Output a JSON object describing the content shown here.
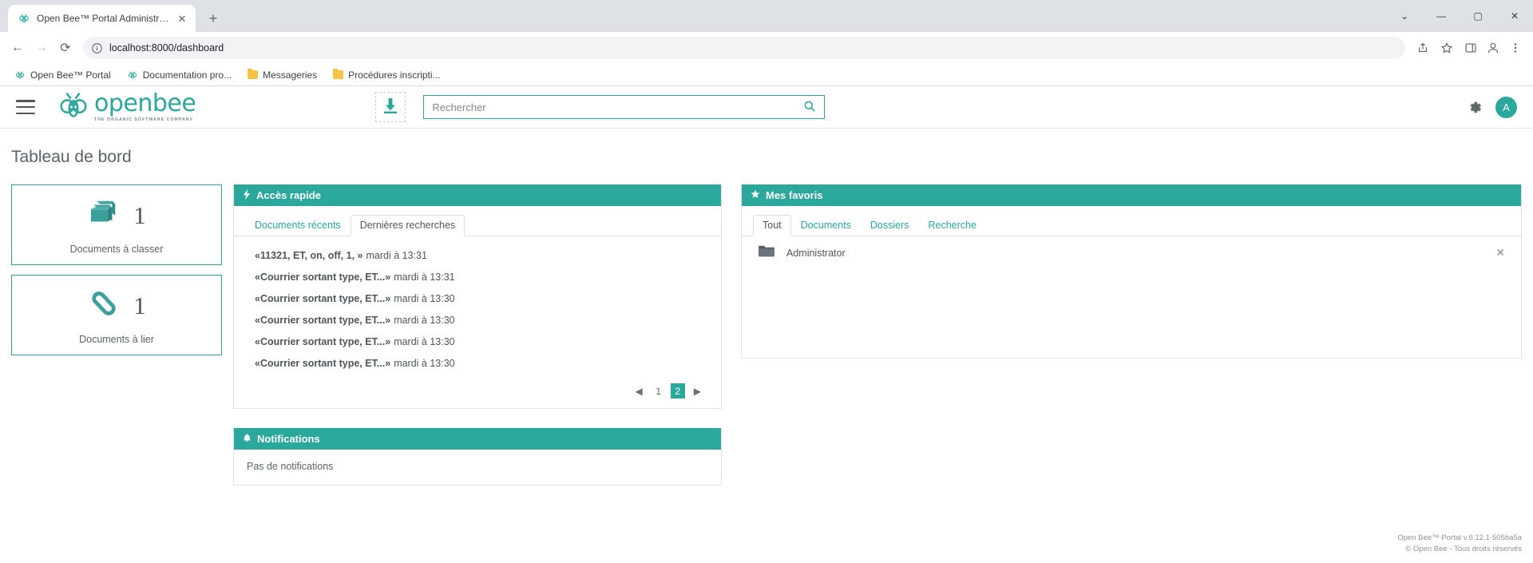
{
  "browser": {
    "tab": {
      "title": "Open Bee™ Portal Administrator",
      "favicon": "bee-icon",
      "close": "✕"
    },
    "newtab_label": "+",
    "window_controls": {
      "minimize": "—",
      "maximize": "▢",
      "close": "✕",
      "chevron": "⌄"
    },
    "nav": {
      "back": "←",
      "forward": "→",
      "reload": "⟳"
    },
    "omnibox": {
      "url": "localhost:8000/dashboard",
      "info_icon": "info-circle-icon"
    },
    "toolbar_icons": {
      "share": "share-icon",
      "bookmark": "star-icon",
      "sidepanel": "side-panel-icon",
      "profile": "profile-icon",
      "menu": "kebab-menu-icon"
    },
    "bookmarks": [
      {
        "label": "Open Bee™ Portal",
        "icon": "bee-icon"
      },
      {
        "label": "Documentation pro...",
        "icon": "bee-icon"
      },
      {
        "label": "Messageries",
        "icon": "folder-icon"
      },
      {
        "label": "Procédures inscripti...",
        "icon": "folder-icon"
      }
    ]
  },
  "app": {
    "header": {
      "menu_icon": "hamburger-menu-icon",
      "logo_word": "openbee",
      "logo_tagline": "THE ORGANIC SOFTWARE COMPANY",
      "upload_icon": "download-upload-icon",
      "search_placeholder": "Rechercher",
      "search_value": "",
      "search_icon": "magnifier-icon",
      "settings_icon": "gear-icon",
      "avatar_letter": "A"
    },
    "page_title": "Tableau de bord",
    "stats": [
      {
        "count": "1",
        "label": "Documents à classer",
        "icon": "documents-stack-icon"
      },
      {
        "count": "1",
        "label": "Documents à lier",
        "icon": "link-chain-icon"
      }
    ],
    "quick_access": {
      "title": "Accès rapide",
      "icon": "lightning-bolt-icon",
      "tabs": [
        {
          "label": "Documents récents",
          "active": false
        },
        {
          "label": "Dernières recherches",
          "active": true
        }
      ],
      "items": [
        {
          "query": "«11321, ET, on, off, 1, »",
          "time": "mardi à 13:31"
        },
        {
          "query": "«Courrier sortant type, ET...»",
          "time": "mardi à 13:31"
        },
        {
          "query": "«Courrier sortant type, ET...»",
          "time": "mardi à 13:30"
        },
        {
          "query": "«Courrier sortant type, ET...»",
          "time": "mardi à 13:30"
        },
        {
          "query": "«Courrier sortant type, ET...»",
          "time": "mardi à 13:30"
        },
        {
          "query": "«Courrier sortant type, ET...»",
          "time": "mardi à 13:30"
        }
      ],
      "pagination": {
        "prev": "◀",
        "next": "▶",
        "pages": [
          "1",
          "2"
        ],
        "current": "2"
      }
    },
    "favorites": {
      "title": "Mes favoris",
      "icon": "star-icon",
      "tabs": [
        {
          "label": "Tout",
          "active": true
        },
        {
          "label": "Documents",
          "active": false
        },
        {
          "label": "Dossiers",
          "active": false
        },
        {
          "label": "Recherche",
          "active": false
        }
      ],
      "items": [
        {
          "name": "Administrator",
          "icon": "folder-icon",
          "remove": "✕"
        }
      ]
    },
    "notifications": {
      "title": "Notifications",
      "icon": "bell-icon",
      "empty_text": "Pas de notifications"
    },
    "footer": {
      "line1": "Open Bee™ Portal v.6.12.1-505ba5a",
      "line2": "© Open Bee - Tous droits réservés"
    },
    "colors": {
      "accent": "#2aa89c",
      "text": "#4f5658"
    }
  }
}
